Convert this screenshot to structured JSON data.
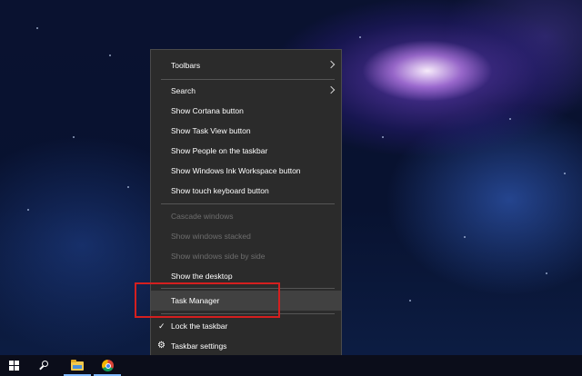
{
  "context_menu": {
    "items": [
      {
        "label": "Toolbars",
        "submenu": true
      },
      {
        "label": "Search",
        "submenu": true
      },
      {
        "label": "Show Cortana button"
      },
      {
        "label": "Show Task View button"
      },
      {
        "label": "Show People on the taskbar"
      },
      {
        "label": "Show Windows Ink Workspace button"
      },
      {
        "label": "Show touch keyboard button"
      },
      {
        "label": "Cascade windows",
        "disabled": true
      },
      {
        "label": "Show windows stacked",
        "disabled": true
      },
      {
        "label": "Show windows side by side",
        "disabled": true
      },
      {
        "label": "Show the desktop"
      },
      {
        "label": "Task Manager",
        "hovered": true
      },
      {
        "label": "Lock the taskbar",
        "checked": true
      },
      {
        "label": "Taskbar settings",
        "icon": "gear-icon"
      }
    ]
  },
  "taskbar": {
    "icons": [
      "windows-start-icon",
      "search-icon",
      "file-explorer-icon",
      "chrome-icon"
    ]
  },
  "annotation": {
    "color": "#d41f1f"
  },
  "colors": {
    "menu_bg": "#2b2b2b",
    "menu_hover": "#414141",
    "text": "#ffffff",
    "text_disabled": "#6e6e6e",
    "taskbar_bg": "#0b0d1a"
  }
}
